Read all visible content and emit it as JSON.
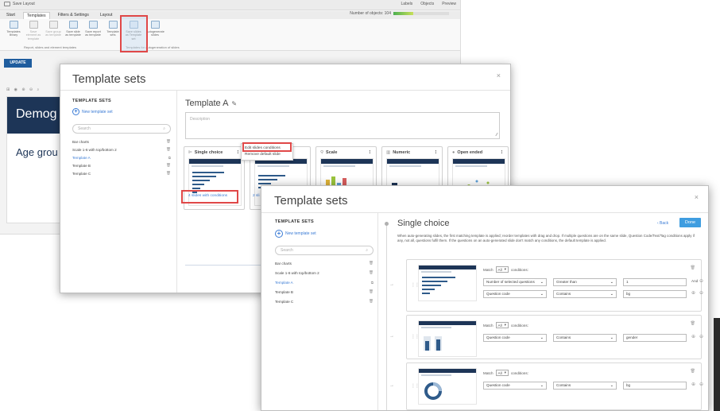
{
  "app": {
    "save_layout": "Save Layout",
    "topbar_right": [
      "Labels",
      "Objects",
      "Preview"
    ],
    "tabs": [
      "Start",
      "Templates",
      "Filters & Settings",
      "Layout"
    ],
    "active_tab": "Templates",
    "objects_label": "Number of objects: 104",
    "objects_fraction": 0.35,
    "ribbon": [
      {
        "label": "Templates library",
        "dim": false
      },
      {
        "label": "Save element as template",
        "dim": true
      },
      {
        "label": "Save group as template",
        "dim": true
      },
      {
        "label": "Save slide as template",
        "dim": false
      },
      {
        "label": "Save report as template",
        "dim": false
      },
      {
        "label": "Template sets",
        "dim": false
      },
      {
        "label": "Save slides as Template set",
        "dim": false
      },
      {
        "label": "Autogenerate slides",
        "dim": false
      }
    ],
    "ribbon_groups": [
      "Report, slides and element templates",
      "Templates for autogeneration of slides"
    ],
    "update": "UPDATE",
    "slide_title": "Demog",
    "slide_subtitle": "Age grou"
  },
  "modal1": {
    "title": "Template sets",
    "close": "×",
    "heading": "TEMPLATE SETS",
    "new_set": "New template set",
    "search_placeholder": "Search",
    "sets": [
      "Bar charts",
      "Scale 1-6 with top/bottom 2",
      "Template A",
      "Template B",
      "Template C"
    ],
    "selected": "Template A",
    "template_name": "Template A",
    "description_placeholder": "Description",
    "cards": [
      {
        "title": "Single choice",
        "icon": "bar"
      },
      {
        "title": "",
        "icon": ""
      },
      {
        "title": "Scale",
        "icon": "scale"
      },
      {
        "title": "Numeric",
        "icon": "numeric"
      },
      {
        "title": "Open ended",
        "icon": "chat"
      }
    ],
    "context_menu": [
      "Edit slides conditions",
      "Remove default slide"
    ],
    "conditions_link": "4 slides with conditions",
    "conditions_link2": "2 sli"
  },
  "modal2": {
    "title": "Template sets",
    "close": "×",
    "heading": "TEMPLATE SETS",
    "new_set": "New template set",
    "search_placeholder": "Search",
    "sets": [
      "Bar charts",
      "Scale 1-6 with top/bottom 2",
      "Template A",
      "Template B",
      "Template C"
    ],
    "selected": "Template A",
    "section_title": "Single choice",
    "back": "‹ Back",
    "done": "Done",
    "help": "When auto-generating slides, the first matching template is applied; reorder templates with drag and drop. If multiple questions are on the same slide, Question Code/Text/Tag conditions apply if any, not all, questions fulfil them. If the questions on an auto-generated slide don't match any conditions, the default template is applied.",
    "blocks": [
      {
        "match_prefix": "Match",
        "match": "All",
        "match_suffix": "conditions:",
        "rows": [
          {
            "field": "Number of selected questions",
            "op": "Greater than",
            "value": "1",
            "and": "And"
          },
          {
            "field": "Question code",
            "op": "Contains",
            "value": "bg",
            "and": ""
          }
        ]
      },
      {
        "match_prefix": "Match",
        "match": "All",
        "match_suffix": "conditions:",
        "rows": [
          {
            "field": "Question code",
            "op": "Contains",
            "value": "gender",
            "and": ""
          }
        ]
      },
      {
        "match_prefix": "Match",
        "match": "All",
        "match_suffix": "conditions:",
        "rows": [
          {
            "field": "Question code",
            "op": "Contains",
            "value": "bg",
            "and": ""
          }
        ]
      }
    ]
  },
  "colors": {
    "accent": "#3a7bd5",
    "highlight": "#e04848",
    "navy": "#1d3557",
    "done": "#3f9de0"
  }
}
